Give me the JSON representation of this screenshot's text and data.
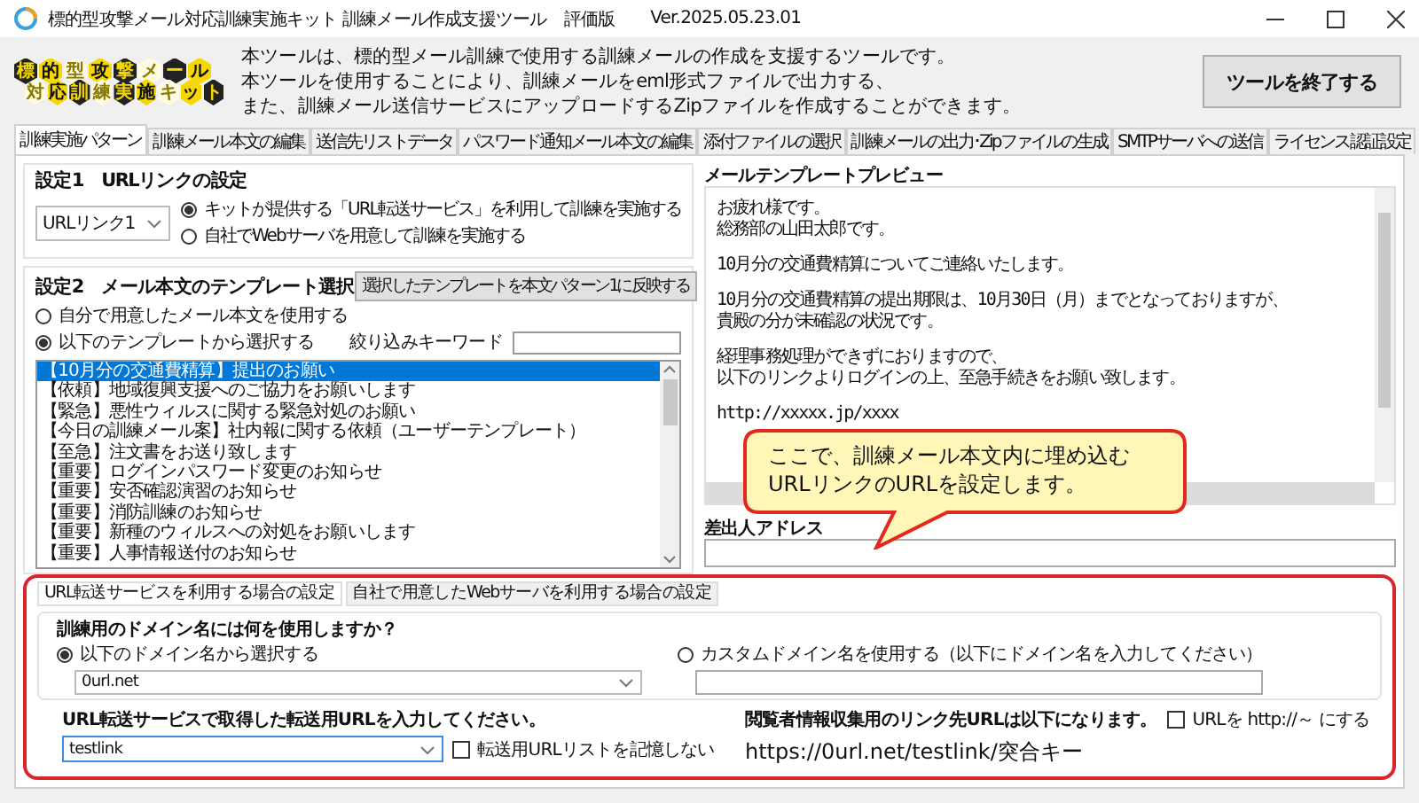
{
  "window": {
    "title": "標的型攻撃メール対応訓練実施キット 訓練メール作成支援ツール　評価版",
    "version": "Ver.2025.05.23.01"
  },
  "logo": {
    "lines": [
      "標的型攻撃メール",
      "対応訓練実施キット"
    ]
  },
  "description": [
    "本ツールは、標的型メール訓練で使用する訓練メールの作成を支援するツールです。",
    "本ツールを使用することにより、訓練メールをeml形式ファイルで出力する、",
    "また、訓練メール送信サービスにアップロードするZipファイルを作成することができます。"
  ],
  "exit_button": "ツールを終了する",
  "tabs": [
    {
      "label": "訓練実施パターン",
      "selected": true
    },
    {
      "label": "訓練メール本文の編集",
      "selected": false
    },
    {
      "label": "送信先リストデータ",
      "selected": false
    },
    {
      "label": "パスワード通知メール本文の編集",
      "selected": false
    },
    {
      "label": "添付ファイルの選択",
      "selected": false
    },
    {
      "label": "訓練メールの出力･Zipファイルの生成",
      "selected": false
    },
    {
      "label": "SMTPサーバへの送信",
      "selected": false
    },
    {
      "label": "ライセンス認証設定",
      "selected": false
    }
  ],
  "setting1": {
    "title": "設定1　URLリンクの設定",
    "link_select": "URLリンク1",
    "options": [
      {
        "label": "キットが提供する「URL転送サービス」を利用して訓練を実施する",
        "selected": true
      },
      {
        "label": "自社でWebサーバを用意して訓練を実施する",
        "selected": false
      }
    ]
  },
  "setting2": {
    "title": "設定2　メール本文のテンプレート選択",
    "apply_button": "選択したテンプレートを本文パターン1に反映する",
    "options": [
      {
        "label": "自分で用意したメール本文を使用する",
        "selected": false
      },
      {
        "label": "以下のテンプレートから選択する",
        "selected": true
      }
    ],
    "filter_label": "絞り込みキーワード",
    "templates": [
      {
        "label": "【10月分の交通費精算】提出のお願い",
        "selected": true
      },
      {
        "label": "【依頼】地域復興支援へのご協力をお願いします",
        "selected": false
      },
      {
        "label": "【緊急】悪性ウィルスに関する緊急対処のお願い",
        "selected": false
      },
      {
        "label": "【今日の訓練メール案】社内報に関する依頼（ユーザーテンプレート）",
        "selected": false
      },
      {
        "label": "【至急】注文書をお送り致します",
        "selected": false
      },
      {
        "label": "【重要】ログインパスワード変更のお知らせ",
        "selected": false
      },
      {
        "label": "【重要】安否確認演習のお知らせ",
        "selected": false
      },
      {
        "label": "【重要】消防訓練のお知らせ",
        "selected": false
      },
      {
        "label": "【重要】新種のウィルスへの対処をお願いします",
        "selected": false
      },
      {
        "label": "【重要】人事情報送付のお知らせ",
        "selected": false
      }
    ]
  },
  "preview": {
    "title": "メールテンプレートプレビュー",
    "paragraphs": [
      [
        "お疲れ様です。",
        "総務部の山田太郎です。"
      ],
      [
        "10月分の交通費精算についてご連絡いたします。"
      ],
      [
        "10月分の交通費精算の提出期限は、10月30日（月）までとなっておりますが、",
        "貴殿の分が未確認の状況です。"
      ],
      [
        "経理事務処理ができずにおりますので、",
        "以下のリンクよりログインの上、至急手続きをお願い致します。"
      ],
      [
        "http://xxxxx.jp/xxxx"
      ]
    ]
  },
  "sender": {
    "label": "差出人アドレス"
  },
  "callout": {
    "lines": [
      "ここで、訓練メール本文内に埋め込む",
      "URLリンクのURLを設定します。"
    ]
  },
  "url_section": {
    "tabs": [
      {
        "label": "URL転送サービスを利用する場合の設定",
        "selected": true
      },
      {
        "label": "自社で用意したWebサーバを利用する場合の設定",
        "selected": false
      }
    ],
    "domain_question": "訓練用のドメイン名には何を使用しますか？",
    "domain_options": [
      {
        "label": "以下のドメイン名から選択する",
        "selected": true
      },
      {
        "label": "カスタムドメイン名を使用する（以下にドメイン名を入力してください）",
        "selected": false
      }
    ],
    "domain_select": "0url.net",
    "url_prompt": "URL転送サービスで取得した転送用URLを入力してください。",
    "url_value": "testlink",
    "no_record": {
      "label": "転送用URLリストを記憶しない",
      "checked": false
    },
    "result_label": "閲覧者情報収集用のリンク先URLは以下になります。",
    "http_option": {
      "label": "URLを http://～ にする",
      "checked": false
    },
    "result_url": "https://0url.net/testlink/突合キー"
  }
}
